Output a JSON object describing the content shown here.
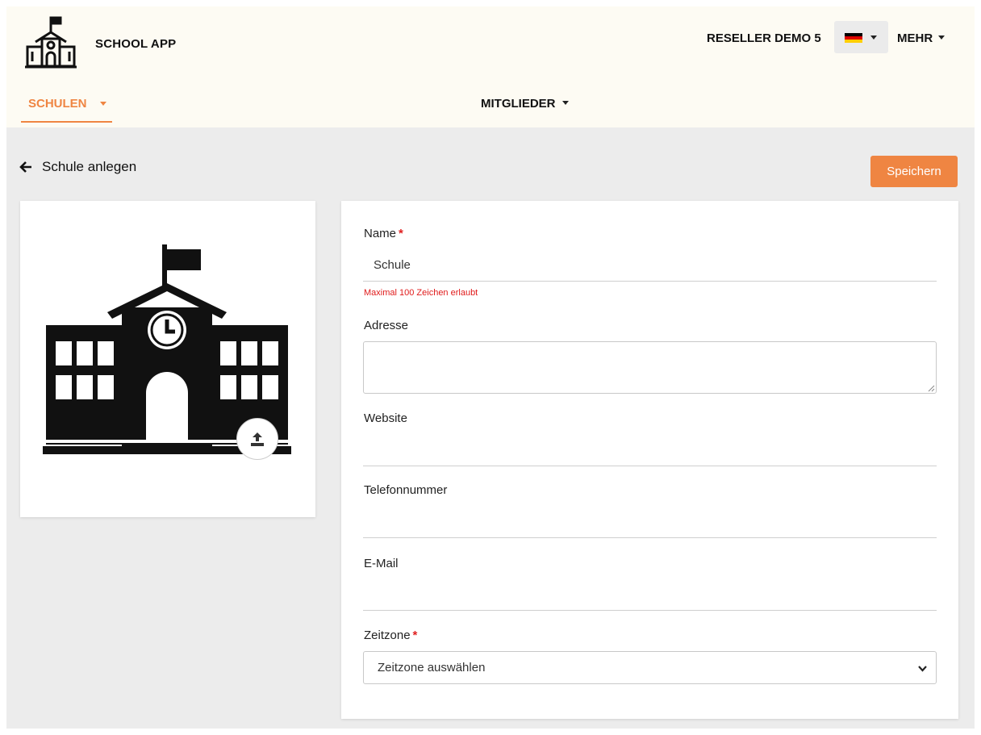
{
  "header": {
    "app_title": "SCHOOL APP",
    "logo_icon": "school-building-icon",
    "reseller": "RESELLER DEMO 5",
    "language": {
      "flag_icon": "germany-flag-icon",
      "flag_colors": [
        "#000000",
        "#dd0000",
        "#ffce00"
      ]
    },
    "more_label": "MEHR"
  },
  "nav": {
    "schools_label": "SCHULEN",
    "members_label": "MITGLIEDER"
  },
  "page": {
    "back_icon": "arrow-left-icon",
    "title": "Schule anlegen",
    "save_label": "Speichern"
  },
  "image_card": {
    "image_icon": "school-building-icon",
    "upload_icon": "upload-icon"
  },
  "form": {
    "name": {
      "label": "Name",
      "required": "*",
      "value": "Schule",
      "hint": "Maximal 100 Zeichen erlaubt"
    },
    "address": {
      "label": "Adresse",
      "value": ""
    },
    "website": {
      "label": "Website",
      "value": ""
    },
    "phone": {
      "label": "Telefonnummer",
      "value": ""
    },
    "email": {
      "label": "E-Mail",
      "value": ""
    },
    "timezone": {
      "label": "Zeitzone",
      "required": "*",
      "selected": "Zeitzone auswählen"
    }
  },
  "colors": {
    "accent": "#ef8542",
    "error": "#e01b1b",
    "header_bg": "#fdfbf3",
    "page_bg": "#ececec"
  }
}
